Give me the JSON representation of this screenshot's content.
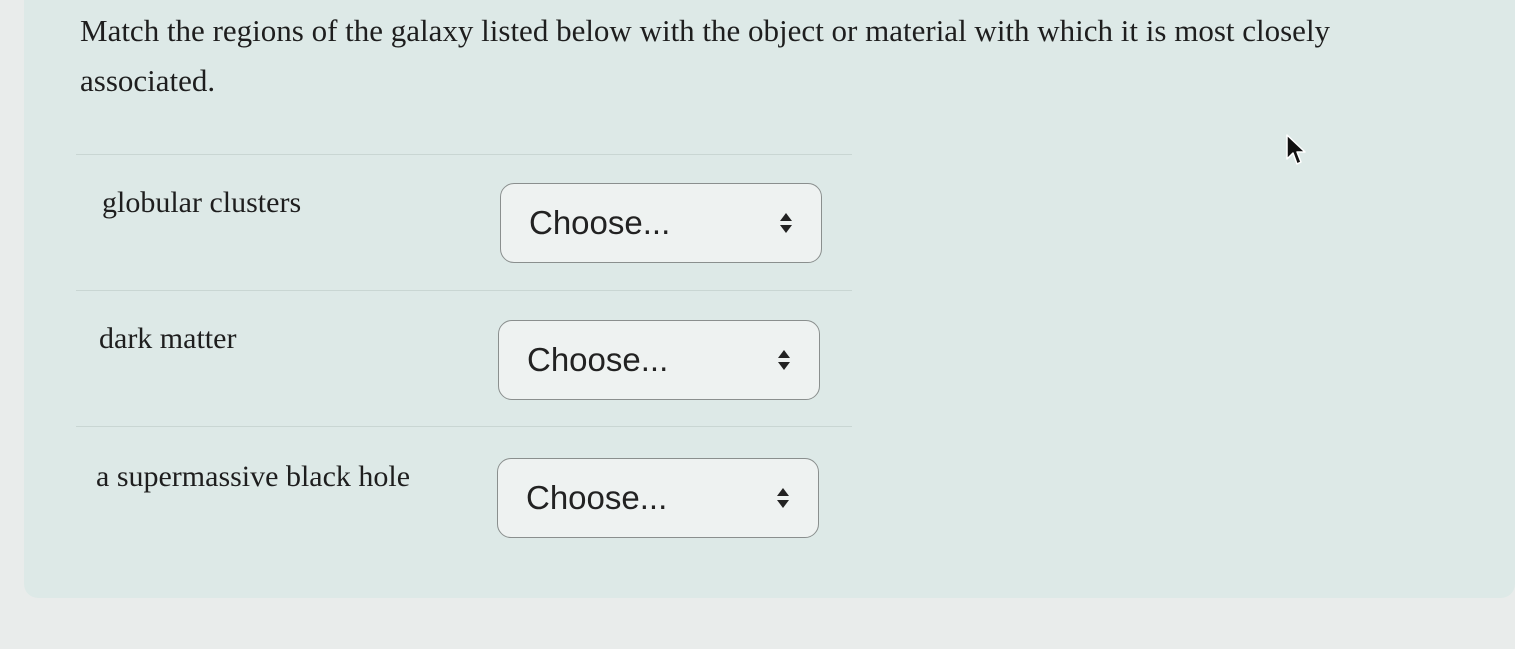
{
  "question": {
    "text": "Match the regions of the galaxy listed below with the object or material with which it is most closely associated."
  },
  "rows": [
    {
      "label": "globular clusters",
      "select_value": "Choose..."
    },
    {
      "label": "dark matter",
      "select_value": "Choose..."
    },
    {
      "label": "a supermassive black hole",
      "select_value": "Choose..."
    }
  ],
  "icons": {
    "select_arrows": "up-down-chevron-icon",
    "cursor": "mouse-pointer-icon"
  },
  "colors": {
    "panel_background": "#dde9e7",
    "page_background": "#e9eceb",
    "select_border": "#8a8f8e",
    "text": "#1e1e1e"
  }
}
